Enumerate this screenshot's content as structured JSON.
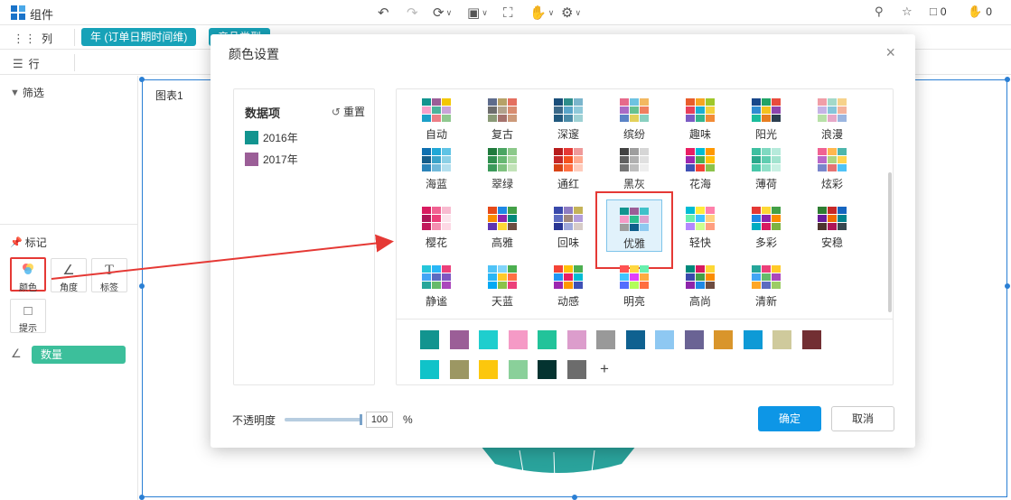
{
  "app": {
    "title": "组件"
  },
  "toolbar_right": {
    "comments": "0",
    "likes": "0"
  },
  "shelves": {
    "columns_label": "列",
    "rows_label": "行",
    "column_pill": "年 (订单日期时间维)",
    "column_pill2": "产品类型"
  },
  "left_panel": {
    "filter_title": "筛选",
    "marks_title": "标记",
    "mark_buttons": [
      "颜色",
      "角度",
      "标签",
      "提示"
    ],
    "measure_pill": "数量"
  },
  "canvas": {
    "title": "图表1"
  },
  "dialog": {
    "title": "颜色设置",
    "data_items_title": "数据项",
    "reset_label": "重置",
    "data_items": [
      {
        "label": "2016年",
        "color": "#12948f"
      },
      {
        "label": "2017年",
        "color": "#9b5e97"
      }
    ],
    "schemes": [
      {
        "label": "自动",
        "colors": [
          "#12948f",
          "#9b5e97",
          "#f3c700",
          "#f6a0c9",
          "#4bb39b",
          "#c9a3d8",
          "#1c9fc8",
          "#ec7e86",
          "#90c890"
        ]
      },
      {
        "label": "复古",
        "colors": [
          "#5e6c8c",
          "#b6a167",
          "#e46f5f",
          "#6d6d6d",
          "#b2a28c",
          "#d88c70",
          "#8a9a77",
          "#a5736d",
          "#cc9a7a"
        ]
      },
      {
        "label": "深邃",
        "colors": [
          "#1a4e7a",
          "#2e8d8b",
          "#7ab5cc",
          "#3b6989",
          "#59a5c9",
          "#8fc9d9",
          "#21597e",
          "#4a8ba8",
          "#9ed1d4"
        ]
      },
      {
        "label": "缤纷",
        "colors": [
          "#e66a8b",
          "#6ec3e1",
          "#f3b861",
          "#a96bc5",
          "#68c190",
          "#f07f5f",
          "#5b83c6",
          "#e3d15b",
          "#8ad0c0"
        ]
      },
      {
        "label": "趣味",
        "colors": [
          "#e85d2b",
          "#f6a521",
          "#9fc82a",
          "#e83f5b",
          "#1caed3",
          "#f4d13b",
          "#7b5cc4",
          "#34b58e",
          "#f28b36"
        ]
      },
      {
        "label": "阳光",
        "colors": [
          "#18478a",
          "#21a366",
          "#e84c3d",
          "#2e8bd1",
          "#f4c21f",
          "#8e44ad",
          "#1abc9c",
          "#e67e22",
          "#2c3e50"
        ]
      },
      {
        "label": "浪漫",
        "colors": [
          "#f09ea7",
          "#a3d9c9",
          "#f6d28b",
          "#c5b3e6",
          "#86c5da",
          "#f4b39c",
          "#b8e0a8",
          "#e6a8c8",
          "#9cb6e0"
        ]
      },
      {
        "label": "海蓝",
        "colors": [
          "#0e6fb0",
          "#1fa7d6",
          "#5ec3e5",
          "#155d8a",
          "#3aa3c9",
          "#8cd0e6",
          "#2a83b8",
          "#6fb8d9",
          "#b3dfee"
        ]
      },
      {
        "label": "翠绿",
        "colors": [
          "#1f7a3c",
          "#4aa562",
          "#8cc98a",
          "#2f8f4e",
          "#67b872",
          "#a9d8a0",
          "#3b9a5a",
          "#7fc27f",
          "#c2e3b8"
        ]
      },
      {
        "label": "通红",
        "colors": [
          "#b71c1c",
          "#e53935",
          "#ef9a9a",
          "#c62828",
          "#f4511e",
          "#ffab91",
          "#d84315",
          "#ff7043",
          "#ffccbc"
        ]
      },
      {
        "label": "黑灰",
        "colors": [
          "#424242",
          "#9e9e9e",
          "#d6d6d6",
          "#616161",
          "#b0b0b0",
          "#e0e0e0",
          "#757575",
          "#bdbdbd",
          "#eeeeee"
        ]
      },
      {
        "label": "花海",
        "colors": [
          "#e91e63",
          "#00bcd4",
          "#ff9800",
          "#9c27b0",
          "#4caf50",
          "#ffc107",
          "#3f51b5",
          "#f44336",
          "#8bc34a"
        ]
      },
      {
        "label": "薄荷",
        "colors": [
          "#3dbfa0",
          "#7fd9c1",
          "#b6eadb",
          "#2aa98c",
          "#5fcdb0",
          "#a2e3cf",
          "#46c7a8",
          "#8fe0c8",
          "#c8f0e3"
        ]
      },
      {
        "label": "炫彩",
        "colors": [
          "#f06292",
          "#ffb74d",
          "#4db6ac",
          "#ba68c8",
          "#aed581",
          "#ffd54f",
          "#7986cb",
          "#e57373",
          "#4fc3f7"
        ]
      },
      {
        "label": "樱花",
        "colors": [
          "#d81b60",
          "#f06292",
          "#f8bbd0",
          "#ad1457",
          "#ec407a",
          "#fce4ec",
          "#c2185b",
          "#f48fb1",
          "#fdd9e5"
        ]
      },
      {
        "label": "高雅",
        "colors": [
          "#e64a19",
          "#1e88e5",
          "#43a047",
          "#fb8c00",
          "#8e24aa",
          "#00897b",
          "#5e35b1",
          "#fdd835",
          "#6d4c41"
        ]
      },
      {
        "label": "回味",
        "colors": [
          "#3949ab",
          "#8e7cc3",
          "#c5b358",
          "#5c6bc0",
          "#a1887f",
          "#b39ddb",
          "#283593",
          "#9fa8da",
          "#d7ccc8"
        ]
      },
      {
        "label": "优雅",
        "colors": [
          "#12948f",
          "#9b5e97",
          "#3fc1c9",
          "#f59ac6",
          "#2cbf8f",
          "#dca2cf",
          "#9e9e9e",
          "#0f5f8c",
          "#8ec9f0"
        ]
      },
      {
        "label": "轻快",
        "colors": [
          "#00bcd4",
          "#ffeb3b",
          "#ff80ab",
          "#69f0ae",
          "#40c4ff",
          "#ffd180",
          "#b388ff",
          "#ccff90",
          "#ff9e80"
        ]
      },
      {
        "label": "多彩",
        "colors": [
          "#e53935",
          "#fdd835",
          "#43a047",
          "#1e88e5",
          "#8e24aa",
          "#fb8c00",
          "#00acc1",
          "#d81b60",
          "#7cb342"
        ]
      },
      {
        "label": "安稳",
        "colors": [
          "#2e7d32",
          "#c62828",
          "#1565c0",
          "#6a1b9a",
          "#ef6c00",
          "#00838f",
          "#4e342e",
          "#ad1457",
          "#37474f"
        ]
      },
      {
        "label": "静谧",
        "colors": [
          "#26c6da",
          "#29b6f6",
          "#ec407a",
          "#42a5f5",
          "#5c6bc0",
          "#7e57c2",
          "#26a69a",
          "#66bb6a",
          "#ab47bc"
        ]
      },
      {
        "label": "天蓝",
        "colors": [
          "#4fc3f7",
          "#81d4fa",
          "#4caf50",
          "#29b6f6",
          "#ffca28",
          "#ff7043",
          "#03a9f4",
          "#8bc34a",
          "#ec407a"
        ]
      },
      {
        "label": "动感",
        "colors": [
          "#f44336",
          "#ffc107",
          "#4caf50",
          "#2196f3",
          "#e91e63",
          "#00bcd4",
          "#9c27b0",
          "#ff9800",
          "#3f51b5"
        ]
      },
      {
        "label": "明亮",
        "colors": [
          "#ff5252",
          "#ffd740",
          "#69f0ae",
          "#40c4ff",
          "#e040fb",
          "#ffab40",
          "#536dfe",
          "#b2ff59",
          "#ff6e40"
        ]
      },
      {
        "label": "高尚",
        "colors": [
          "#00897b",
          "#d81b60",
          "#fdd835",
          "#3949ab",
          "#43a047",
          "#fb8c00",
          "#8e24aa",
          "#1e88e5",
          "#6d4c41"
        ]
      },
      {
        "label": "清新",
        "colors": [
          "#26a69a",
          "#ec407a",
          "#ffca28",
          "#42a5f5",
          "#66bb6a",
          "#ab47bc",
          "#ffa726",
          "#5c6bc0",
          "#9ccc65"
        ]
      }
    ],
    "selected_scheme": "优雅",
    "palette": [
      "#12948f",
      "#9b5e97",
      "#1fcece",
      "#f59ac6",
      "#22c39a",
      "#dc9dcc",
      "#999999",
      "#0f6190",
      "#8ec8f2",
      "#6a6394",
      "#d9952b",
      "#0e9ad6",
      "#cfca9c",
      "#722f33",
      "#10c3c9",
      "#9c9763",
      "#fcc70d",
      "#8ad09a",
      "#043330",
      "#6c6c6c"
    ],
    "add_label": "+",
    "opacity_label": "不透明度",
    "opacity_value": "100",
    "opacity_fraction": 1.0,
    "opacity_unit": "%",
    "ok_label": "确定",
    "cancel_label": "取消"
  }
}
